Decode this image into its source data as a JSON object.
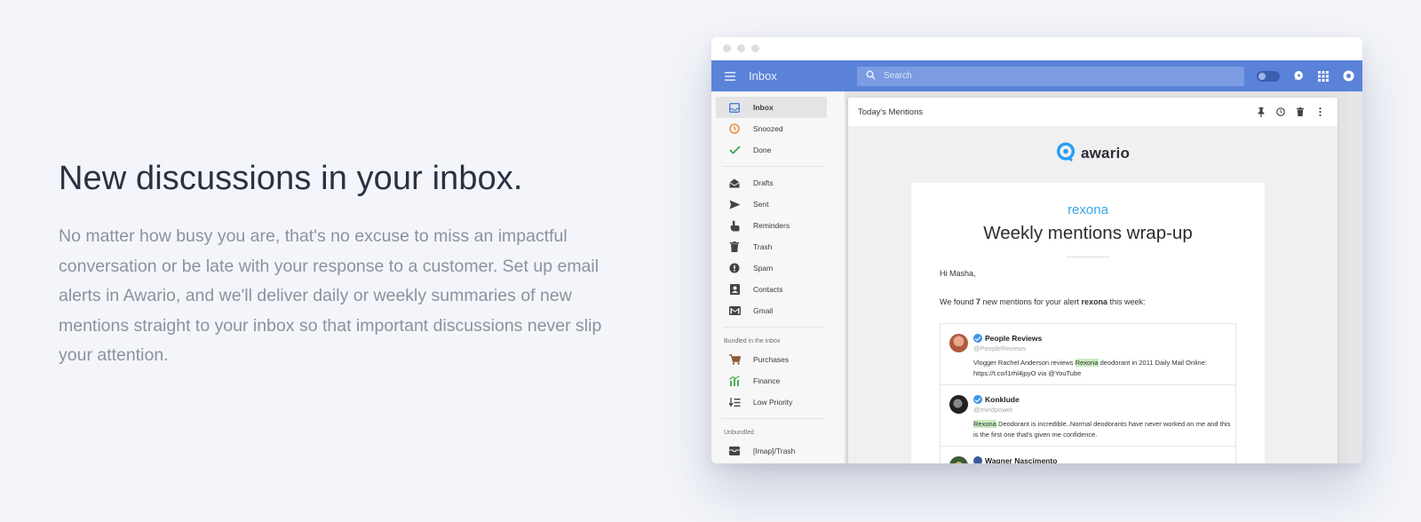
{
  "hero": {
    "title": "New discussions in your inbox.",
    "body": "No matter how busy you are, that's no excuse to miss an impactful conversation or be late with your response to a customer. Set up email alerts in Awario, and we'll deliver daily or weekly summaries of new mentions straight to your inbox so that important discussions never slip your attention."
  },
  "appbar": {
    "title": "Inbox",
    "search_placeholder": "Search"
  },
  "sidebar": {
    "primary": [
      {
        "label": "Inbox",
        "icon": "inbox-icon",
        "active": true
      },
      {
        "label": "Snoozed",
        "icon": "clock-icon"
      },
      {
        "label": "Done",
        "icon": "check-icon"
      }
    ],
    "secondary": [
      {
        "label": "Drafts",
        "icon": "drafts-icon"
      },
      {
        "label": "Sent",
        "icon": "send-icon"
      },
      {
        "label": "Reminders",
        "icon": "hand-icon"
      },
      {
        "label": "Trash",
        "icon": "trash-icon"
      },
      {
        "label": "Spam",
        "icon": "alert-icon"
      },
      {
        "label": "Contacts",
        "icon": "contacts-icon"
      },
      {
        "label": "Gmail",
        "icon": "gmail-icon"
      }
    ],
    "bundled_title": "Bundled in the inbox",
    "bundled": [
      {
        "label": "Purchases",
        "icon": "cart-icon"
      },
      {
        "label": "Finance",
        "icon": "finance-icon"
      },
      {
        "label": "Low Priority",
        "icon": "low-priority-icon"
      }
    ],
    "unbundled_title": "Unbundled",
    "unbundled": [
      {
        "label": "[Imap]/Trash",
        "icon": "folder-icon"
      }
    ]
  },
  "panel": {
    "title": "Today's Mentions"
  },
  "email": {
    "brand": "awario",
    "alert_name": "rexona",
    "heading": "Weekly mentions wrap-up",
    "greeting": "Hi Masha,",
    "summary_prefix": "We found ",
    "summary_count": "7",
    "summary_middle": " new mentions for your alert ",
    "summary_alert": "rexona",
    "summary_suffix": " this week:",
    "mentions": [
      {
        "name": "People Reviews",
        "handle": "@PeopleReviews",
        "text_before": "Vlogger Rachel Anderson reviews ",
        "highlight": "Rexona",
        "text_after": " deodorant in 2011 Daily Mail Online: https://t.co/l1rhl4jpyO via @YouTube"
      },
      {
        "name": "Konklude",
        "handle": "@mindpower",
        "text_before": "",
        "highlight": "Rexona",
        "text_after": " Deodorant is incredible..Normal deodorants have never worked on me and this is the first one that's given me confidence."
      },
      {
        "name": "Wagner Nascimento"
      }
    ]
  },
  "colors": {
    "appbar": "#5a82d8",
    "accent": "#3aa6e8",
    "highlight": "#c9ecbf"
  }
}
